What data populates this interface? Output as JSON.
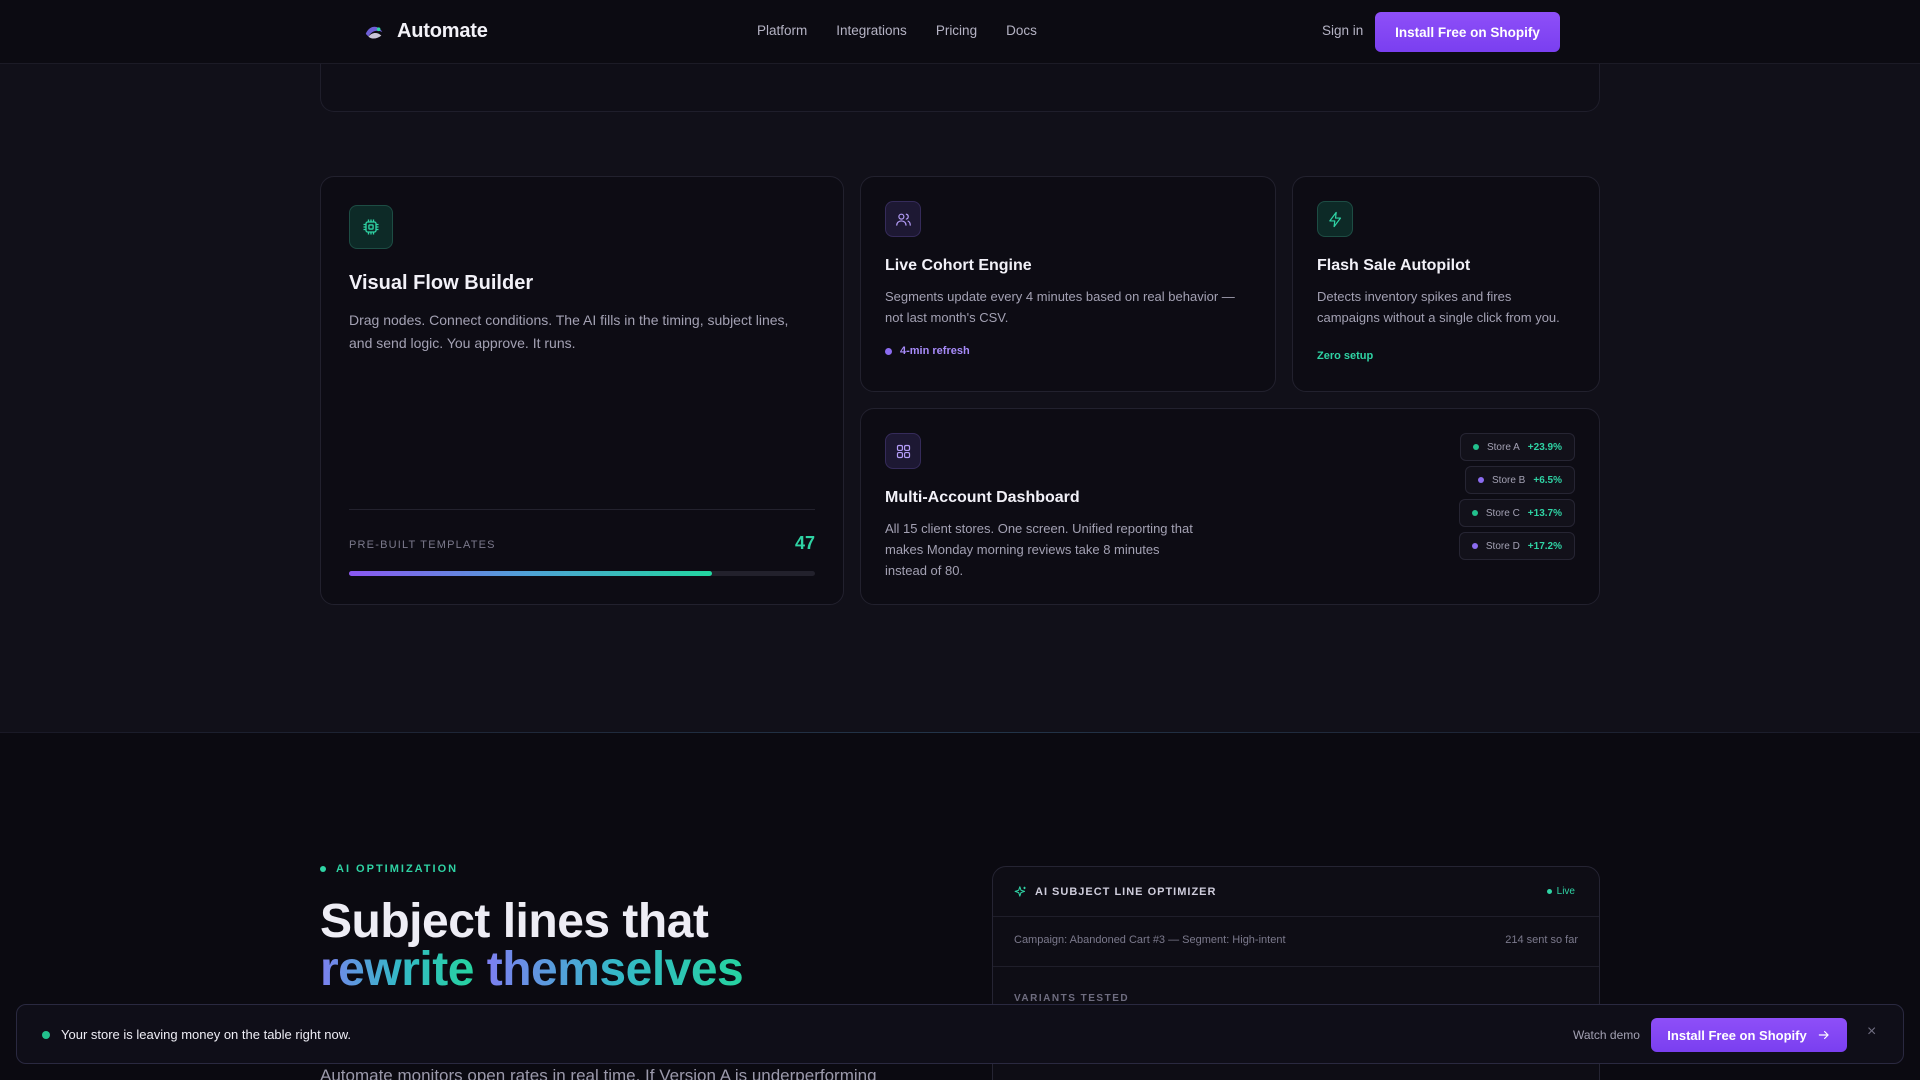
{
  "nav": {
    "brand": "Automate",
    "links": [
      "Platform",
      "Integrations",
      "Pricing",
      "Docs"
    ],
    "signin": "Sign in",
    "cta": "Install Free on Shopify"
  },
  "features": {
    "flow": {
      "title": "Visual Flow Builder",
      "desc": "Drag nodes. Connect conditions. The AI fills in the timing, subject lines, and send logic. You approve. It runs.",
      "templates_label": "PRE-BUILT TEMPLATES",
      "templates_count": "47",
      "templates_progress": 0.78
    },
    "cohort": {
      "title": "Live Cohort Engine",
      "desc": "Segments update every 4 minutes based on real behavior — not last month's CSV.",
      "tag": "4-min refresh"
    },
    "flash": {
      "title": "Flash Sale Autopilot",
      "desc": "Detects inventory spikes and fires campaigns without a single click from you.",
      "tag": "Zero setup"
    },
    "multi": {
      "title": "Multi-Account Dashboard",
      "desc": "All 15 client stores. One screen. Unified reporting that makes Monday morning reviews take 8 minutes instead of 80.",
      "stores": [
        {
          "name": "Store A",
          "change": "+23.9%",
          "color": "#22c08d"
        },
        {
          "name": "Store B",
          "change": "+6.5%",
          "color": "#8b6cf0"
        },
        {
          "name": "Store C",
          "change": "+13.7%",
          "color": "#22c08d"
        },
        {
          "name": "Store D",
          "change": "+17.2%",
          "color": "#8b6cf0"
        }
      ]
    }
  },
  "ai": {
    "eyebrow": "AI OPTIMIZATION",
    "headline_1": "Subject lines that",
    "headline_2a": "rewrite",
    "headline_2b": "themselves",
    "subcopy": "Automate monitors open rates in real time. If Version A is underperforming",
    "panel": {
      "title": "AI SUBJECT LINE OPTIMIZER",
      "status": "Live",
      "campaign": "Campaign: Abandoned Cart #3 — Segment: High-intent",
      "sent": "214 sent so far",
      "variants_label": "VARIANTS TESTED"
    }
  },
  "banner": {
    "text": "Your store is leaving money on the table right now.",
    "watch": "Watch demo",
    "cta": "Install Free on Shopify",
    "close": "×"
  },
  "colors": {
    "accent_purple": "#8e4ff8",
    "accent_green": "#2fd3a4",
    "background": "#111019"
  }
}
